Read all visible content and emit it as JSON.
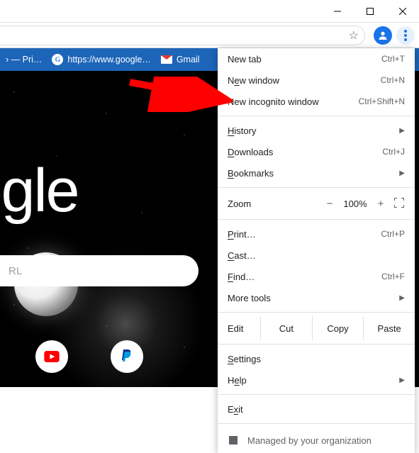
{
  "bookmarks": {
    "pri": "› — Pri…",
    "google_url": "https://www.google…",
    "gmail": "Gmail"
  },
  "page": {
    "logo": "oogle",
    "search_placeholder": "RL"
  },
  "menu": {
    "new_tab": {
      "label": "New tab",
      "shortcut": "Ctrl+T"
    },
    "new_window": {
      "label_pre": "N",
      "label_u": "e",
      "label_post": "w window",
      "shortcut": "Ctrl+N"
    },
    "new_incognito": {
      "label": "New incognito window",
      "shortcut": "Ctrl+Shift+N"
    },
    "history": {
      "label_u": "H",
      "label_post": "istory"
    },
    "downloads": {
      "label_u": "D",
      "label_post": "ownloads",
      "shortcut": "Ctrl+J"
    },
    "bookmarks": {
      "label_u": "B",
      "label_post": "ookmarks"
    },
    "zoom": {
      "label": "Zoom",
      "value": "100%"
    },
    "print": {
      "label_u": "P",
      "label_post": "rint…",
      "shortcut": "Ctrl+P"
    },
    "cast": {
      "label_u": "C",
      "label_post": "ast…"
    },
    "find": {
      "label_u": "F",
      "label_post": "ind…",
      "shortcut": "Ctrl+F"
    },
    "more_tools": {
      "label": "More tools"
    },
    "edit": {
      "label": "Edit",
      "cut": "Cut",
      "copy": "Copy",
      "paste": "Paste"
    },
    "settings": {
      "label_u": "S",
      "label_post": "ettings"
    },
    "help": {
      "label": "H",
      "label_u": "e",
      "label_post": "lp"
    },
    "exit": {
      "label": "E",
      "label_u": "x",
      "label_post": "it"
    },
    "managed": "Managed by your organization"
  }
}
